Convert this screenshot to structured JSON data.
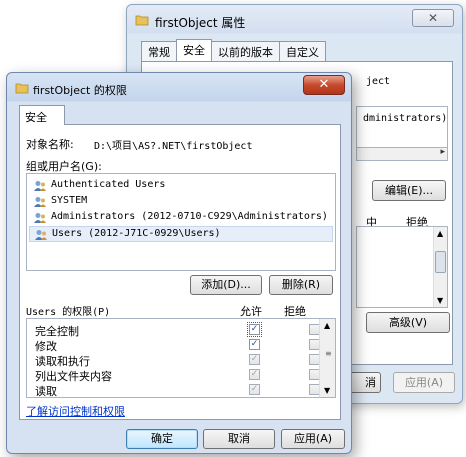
{
  "bg_window": {
    "title": "firstObject 属性",
    "close_glyph": "✕",
    "tabs": [
      {
        "label": "常规"
      },
      {
        "label": "安全",
        "active": true
      },
      {
        "label": "以前的版本"
      },
      {
        "label": "自定义"
      }
    ],
    "object_fragment": "ject",
    "listbox_fragment": "dministrators)",
    "edit_label": "编辑(E)...",
    "allow_fragment": "中",
    "deny_label": "拒绝",
    "advanced_label": "高级(V)",
    "cancel_fragment": "消",
    "apply_label": "应用(A)"
  },
  "dialog": {
    "title": "firstObject 的权限",
    "close_glyph": "✕",
    "tab_label": "安全",
    "object_name_label": "对象名称:",
    "object_name_value": "D:\\项目\\AS?.NET\\firstObject",
    "group_label": "组或用户名(G):",
    "users": [
      {
        "name": "Authenticated Users",
        "selected": false
      },
      {
        "name": "SYSTEM",
        "selected": false
      },
      {
        "name": "Administrators (2012-0710-C929\\Administrators)",
        "selected": false
      },
      {
        "name": "Users (2012-J71C-0929\\Users)",
        "selected": true
      }
    ],
    "add_label": "添加(D)...",
    "remove_label": "删除(R)",
    "permissions_for_label": "Users 的权限(P)",
    "allow_header": "允许",
    "deny_header": "拒绝",
    "permissions": [
      {
        "name": "完全控制",
        "allow": true,
        "deny": false
      },
      {
        "name": "修改",
        "allow": true,
        "deny": false
      },
      {
        "name": "读取和执行",
        "allow": true,
        "deny": false
      },
      {
        "name": "列出文件夹内容",
        "allow": true,
        "deny": false
      },
      {
        "name": "读取",
        "allow": true,
        "deny": false
      }
    ],
    "learn_link": "了解访问控制和权限",
    "ok_label": "确定",
    "cancel_label": "取消",
    "apply_label": "应用(A)"
  },
  "colors": {
    "title_glass": "#c4d5ec",
    "close_red": "#c64a2c",
    "link_blue": "#0033cc",
    "selection": "#e6eef9"
  }
}
